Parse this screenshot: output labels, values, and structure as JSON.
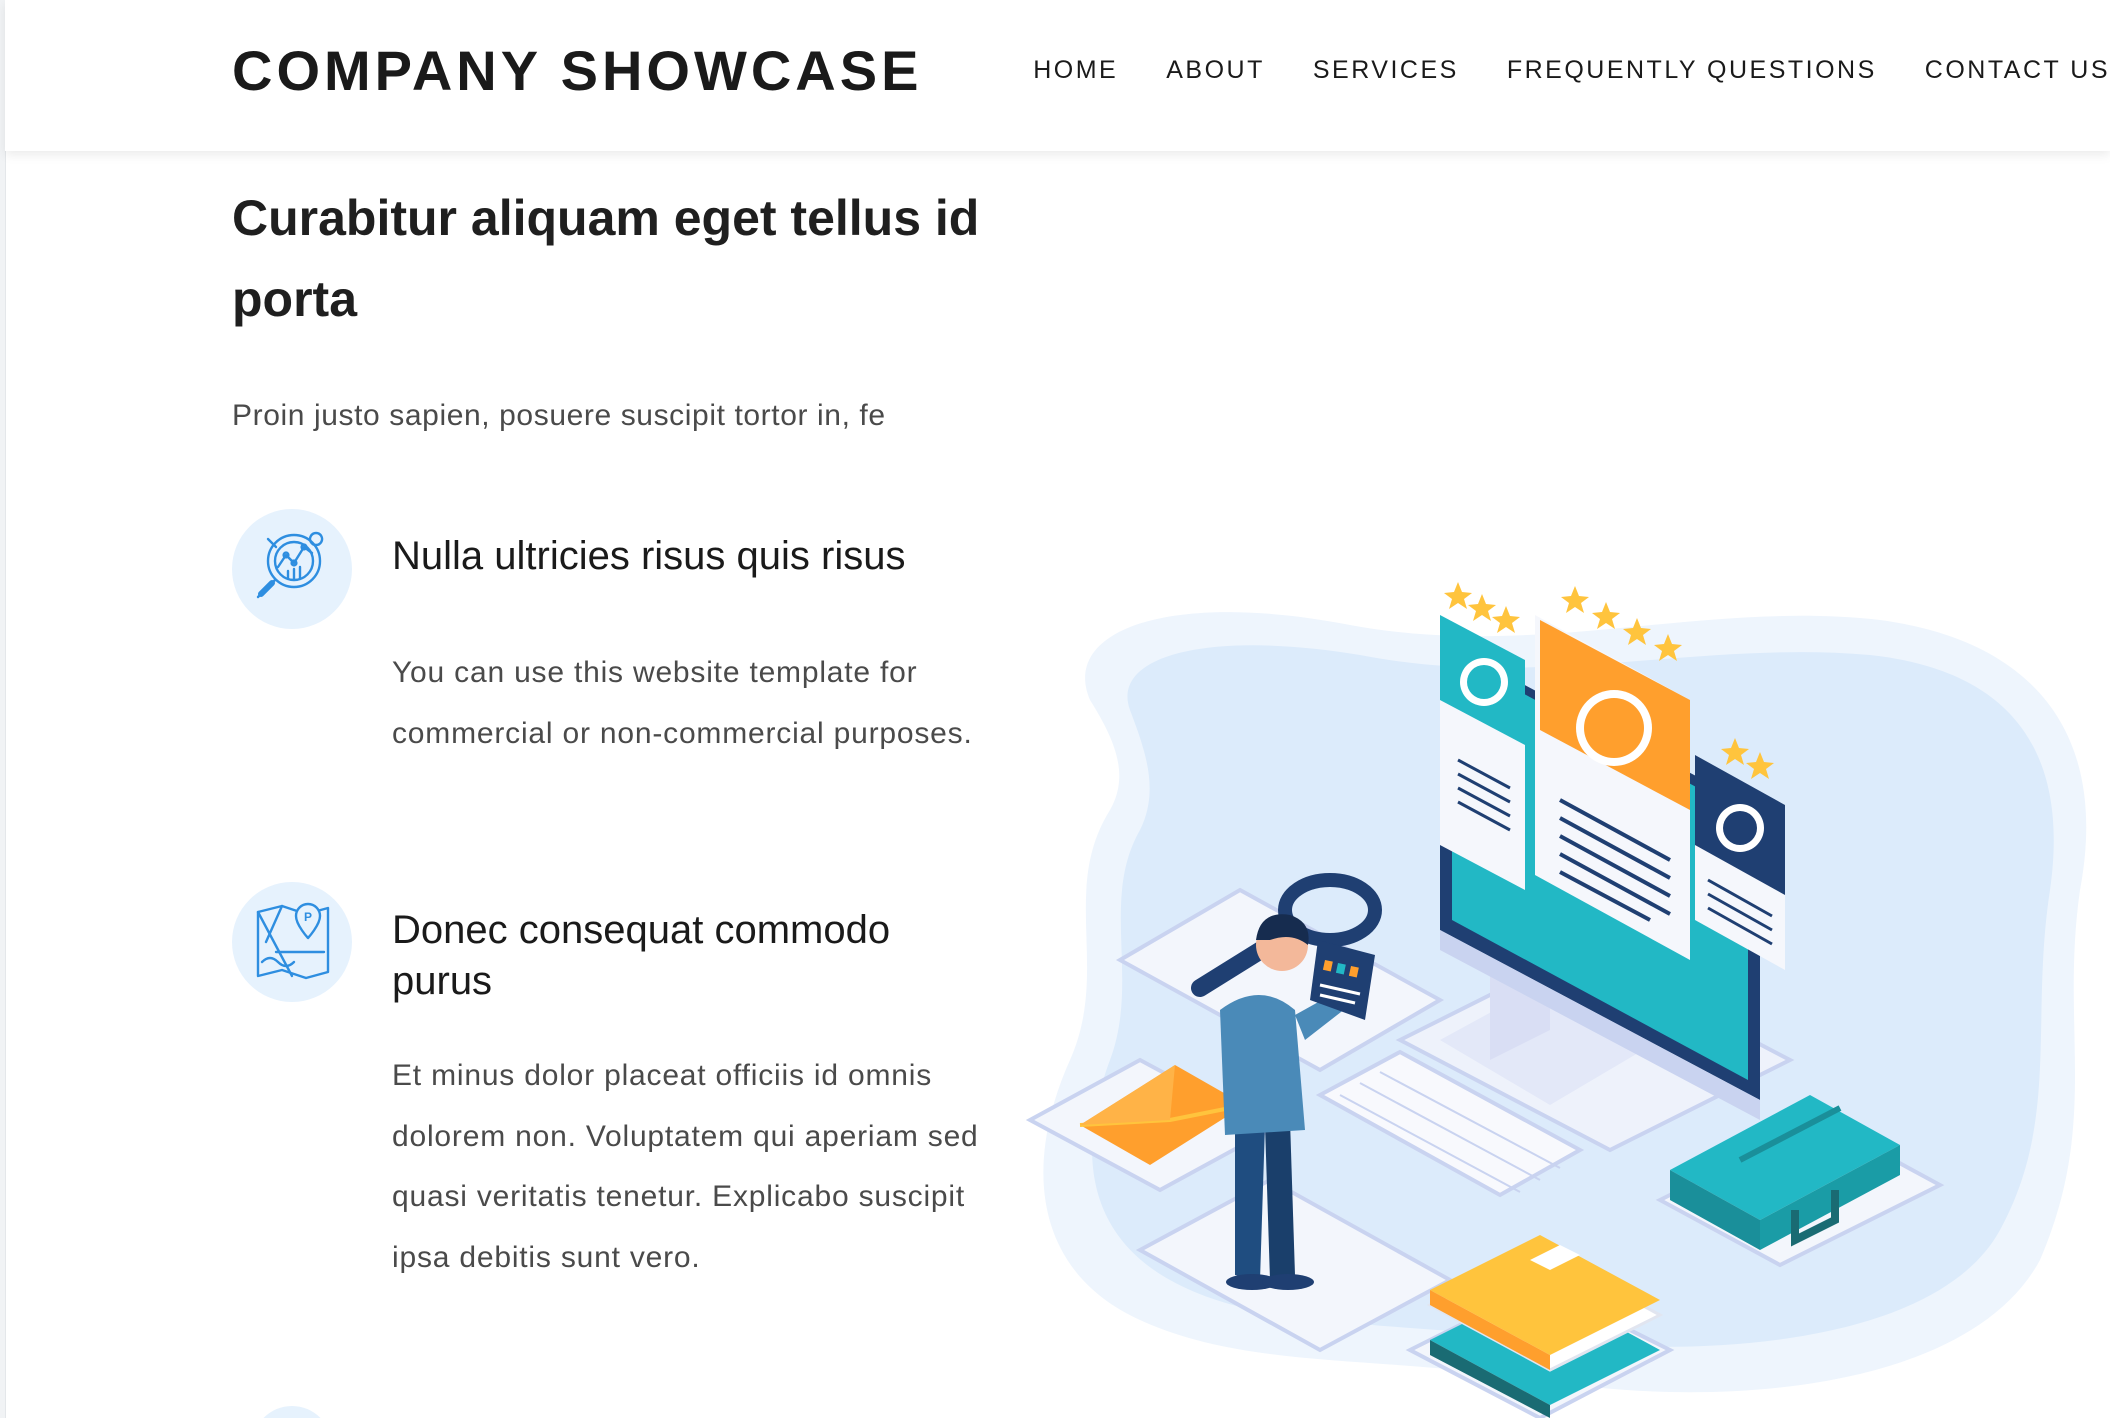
{
  "header": {
    "brand": "COMPANY SHOWCASE",
    "nav": [
      "HOME",
      "ABOUT",
      "SERVICES",
      "FREQUENTLY QUESTIONS",
      "CONTACT US"
    ]
  },
  "hero": {
    "title": "Curabitur aliquam eget tellus id porta",
    "subtitle": "Proin justo sapien, posuere suscipit tortor in, fe"
  },
  "features": [
    {
      "icon": "analytics-search-icon",
      "title": "Nulla ultricies risus quis risus",
      "text": "You can use this website template for commercial or non-commercial purposes."
    },
    {
      "icon": "map-location-icon",
      "title": "Donec consequat commodo purus",
      "text": "Et minus dolor placeat officiis id omnis dolorem non. Voluptatem qui aperiam sed quasi veritatis tenetur. Explicabo suscipit ipsa debitis sunt vero."
    }
  ],
  "colors": {
    "icon_blue": "#2e8ee0",
    "icon_bg": "#e6f2fd",
    "teal": "#22b8c5",
    "orange": "#ff9f2d",
    "navy": "#1f3f72",
    "yellow": "#ffc43d",
    "blob": "#dcebfb"
  }
}
